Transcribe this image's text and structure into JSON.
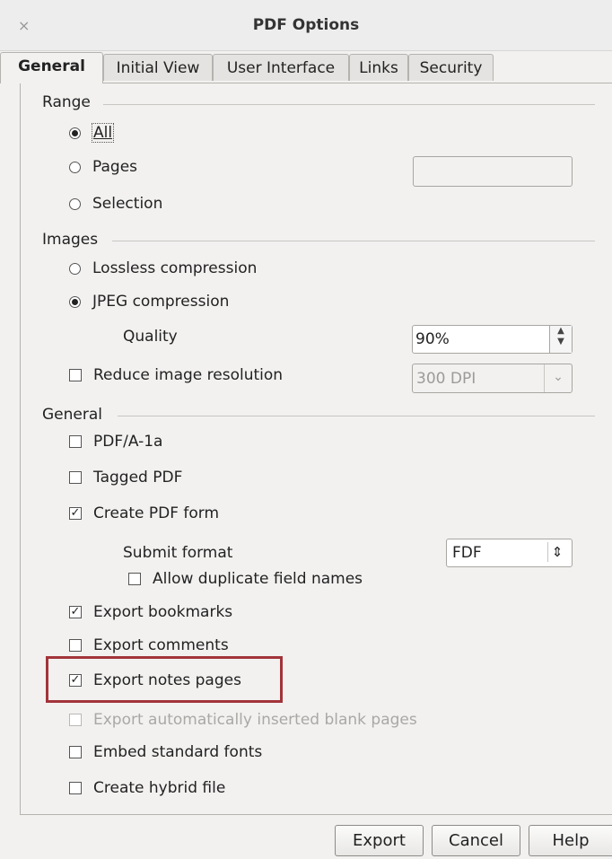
{
  "window": {
    "title": "PDF Options",
    "close_glyph": "×"
  },
  "tabs": [
    {
      "label": "General",
      "active": true
    },
    {
      "label": "Initial View",
      "active": false
    },
    {
      "label": "User Interface",
      "active": false
    },
    {
      "label": "Links",
      "active": false
    },
    {
      "label": "Security",
      "active": false
    }
  ],
  "range": {
    "label": "Range",
    "options": [
      {
        "label": "All",
        "selected": true
      },
      {
        "label": "Pages",
        "selected": false
      },
      {
        "label": "Selection",
        "selected": false
      }
    ],
    "pages_value": ""
  },
  "images": {
    "label": "Images",
    "options": [
      {
        "label": "Lossless compression",
        "selected": false
      },
      {
        "label": "JPEG compression",
        "selected": true
      }
    ],
    "quality_label": "Quality",
    "quality_value": "90%",
    "reduce_label": "Reduce image resolution",
    "reduce_checked": false,
    "resolution_value": "300 DPI"
  },
  "general": {
    "label": "General",
    "pdfa": {
      "label": "PDF/A-1a",
      "checked": false
    },
    "tagged": {
      "label": "Tagged PDF",
      "checked": false
    },
    "create_form": {
      "label": "Create PDF form",
      "checked": true
    },
    "submit_format_label": "Submit format",
    "submit_format_value": "FDF",
    "allow_duplicate": {
      "label": "Allow duplicate field names",
      "checked": false
    },
    "export_bookmarks": {
      "label": "Export bookmarks",
      "checked": true
    },
    "export_comments": {
      "label": "Export comments",
      "checked": false
    },
    "export_notes": {
      "label": "Export notes pages",
      "checked": true
    },
    "export_blank": {
      "label": "Export automatically inserted blank pages",
      "checked": false,
      "disabled": true
    },
    "embed_fonts": {
      "label": "Embed standard fonts",
      "checked": false
    },
    "hybrid": {
      "label": "Create hybrid file",
      "checked": false
    }
  },
  "buttons": {
    "export": "Export",
    "cancel": "Cancel",
    "help": "Help"
  },
  "colors": {
    "highlight": "#a2343a",
    "background": "#f2f1f0"
  },
  "glyphs": {
    "check": "✓",
    "dropdown": "⌄",
    "up_down": "⇕"
  }
}
